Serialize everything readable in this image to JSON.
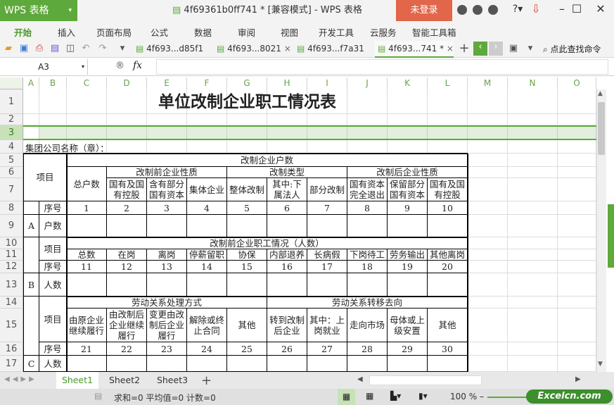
{
  "app": {
    "logo": "WPS 表格",
    "title": "4f69361b0ff741 * [兼容模式] - WPS 表格",
    "login": "未登录"
  },
  "menu": [
    "开始",
    "插入",
    "页面布局",
    "公式",
    "数据",
    "审阅",
    "视图",
    "开发工具",
    "云服务",
    "智能工具箱"
  ],
  "doc_tabs": [
    {
      "label": "4f693...d85f1",
      "active": false
    },
    {
      "label": "4f693...8021",
      "active": false
    },
    {
      "label": "4f693...f7a31",
      "active": false
    },
    {
      "label": "4f693...741 *",
      "active": true
    }
  ],
  "search_label": "点此查找命令",
  "formula": {
    "name_box": "A3",
    "fx": "fx",
    "value": ""
  },
  "columns": [
    "A",
    "B",
    "C",
    "D",
    "E",
    "F",
    "G",
    "H",
    "I",
    "J",
    "K",
    "L",
    "M",
    "N",
    "O"
  ],
  "rows": [
    "1",
    "2",
    "3",
    "4",
    "5",
    "6",
    "7",
    "8",
    "9",
    "10",
    "11",
    "12",
    "13",
    "14",
    "15",
    "16",
    "17"
  ],
  "selected_row": "3",
  "sheet": {
    "title": "单位改制企业职工情况表",
    "company_label": "集团公司名称（章）：",
    "item": "项目",
    "seq": "序号",
    "A": "A",
    "B": "B",
    "C": "C",
    "households": "户数",
    "people": "人数",
    "sec1": {
      "header": "改制企业户数",
      "total": "总户数",
      "g1": "改制前企业性质",
      "g2": "改制类型",
      "g3": "改制后企业性质",
      "labels": [
        "国有及国\n有控股",
        "含有部分\n国有资本",
        "集体企业",
        "整体改制",
        "其中:下\n属法人",
        "部分改制",
        "国有资本\n完全退出",
        "保留部分\n国有资本",
        "国有及国\n有控股"
      ],
      "numbers": [
        "1",
        "2",
        "3",
        "4",
        "5",
        "6",
        "7",
        "8",
        "9",
        "10"
      ]
    },
    "sec2": {
      "header": "改制前企业职工情况（人数）",
      "labels": [
        "总数",
        "在岗",
        "离岗",
        "停薪留职",
        "协保",
        "内部退养",
        "长病假",
        "下岗待工",
        "劳务输出",
        "其他离岗"
      ],
      "numbers": [
        "11",
        "12",
        "13",
        "14",
        "15",
        "16",
        "17",
        "18",
        "19",
        "20"
      ]
    },
    "sec3": {
      "g1": "劳动关系处理方式",
      "g2": "劳动关系转移去向",
      "labels": [
        "由原企业\n继续履行",
        "由改制后\n企业继续\n履行",
        "变更由改\n制后企业\n履行",
        "解除或终\n止合同",
        "其他",
        "转到改制\n后企业",
        "其中：上\n岗就业",
        "走向市场",
        "母体或上\n级安置",
        "其他"
      ],
      "numbers": [
        "21",
        "22",
        "23",
        "24",
        "25",
        "26",
        "27",
        "28",
        "29",
        "30"
      ]
    }
  },
  "sheets": [
    {
      "label": "Sheet1",
      "active": true
    },
    {
      "label": "Sheet2",
      "active": false
    },
    {
      "label": "Sheet3",
      "active": false
    }
  ],
  "status": {
    "text": "求和=0  平均值=0  计数=0",
    "zoom": "100 %"
  },
  "brand": "Excelcn.com",
  "colors": {
    "accent": "#5ea93c",
    "login": "#e2664a"
  }
}
